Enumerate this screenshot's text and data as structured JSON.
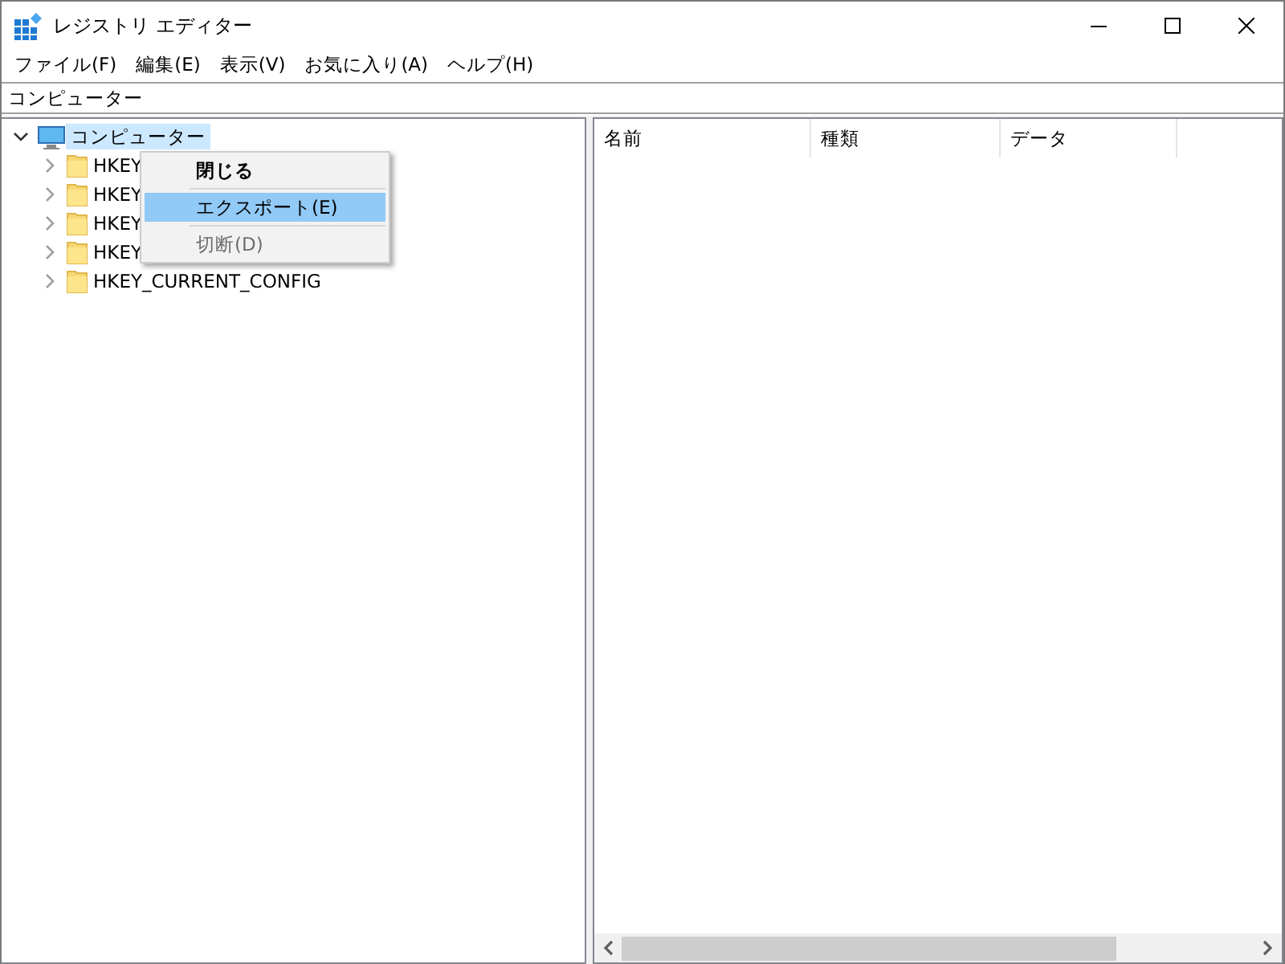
{
  "window": {
    "title": "レジストリ エディター"
  },
  "menu_bar": [
    "ファイル(F)",
    "編集(E)",
    "表示(V)",
    "お気に入り(A)",
    "ヘルプ(H)"
  ],
  "address_bar": {
    "value": "コンピューター"
  },
  "tree": {
    "label": "コンピューター",
    "expanded": true,
    "selected": true,
    "children": [
      {
        "label": "HKEY",
        "expanded": false,
        "selected": false
      },
      {
        "label": "HKEY",
        "expanded": false,
        "selected": false
      },
      {
        "label": "HKEY",
        "expanded": false,
        "selected": false
      },
      {
        "label": "HKEY",
        "expanded": false,
        "selected": false
      },
      {
        "label": "HKEY_CURRENT_CONFIG",
        "expanded": false,
        "selected": false
      }
    ]
  },
  "context_menu": [
    {
      "label": "閉じる",
      "default": true,
      "selected": false,
      "disabled": false
    },
    {
      "label": "エクスポート(E)",
      "default": false,
      "selected": true,
      "disabled": false
    },
    {
      "label": "切断(D)",
      "default": false,
      "selected": false,
      "disabled": true
    }
  ],
  "list": {
    "columns": [
      "名前",
      "種類",
      "データ"
    ]
  }
}
